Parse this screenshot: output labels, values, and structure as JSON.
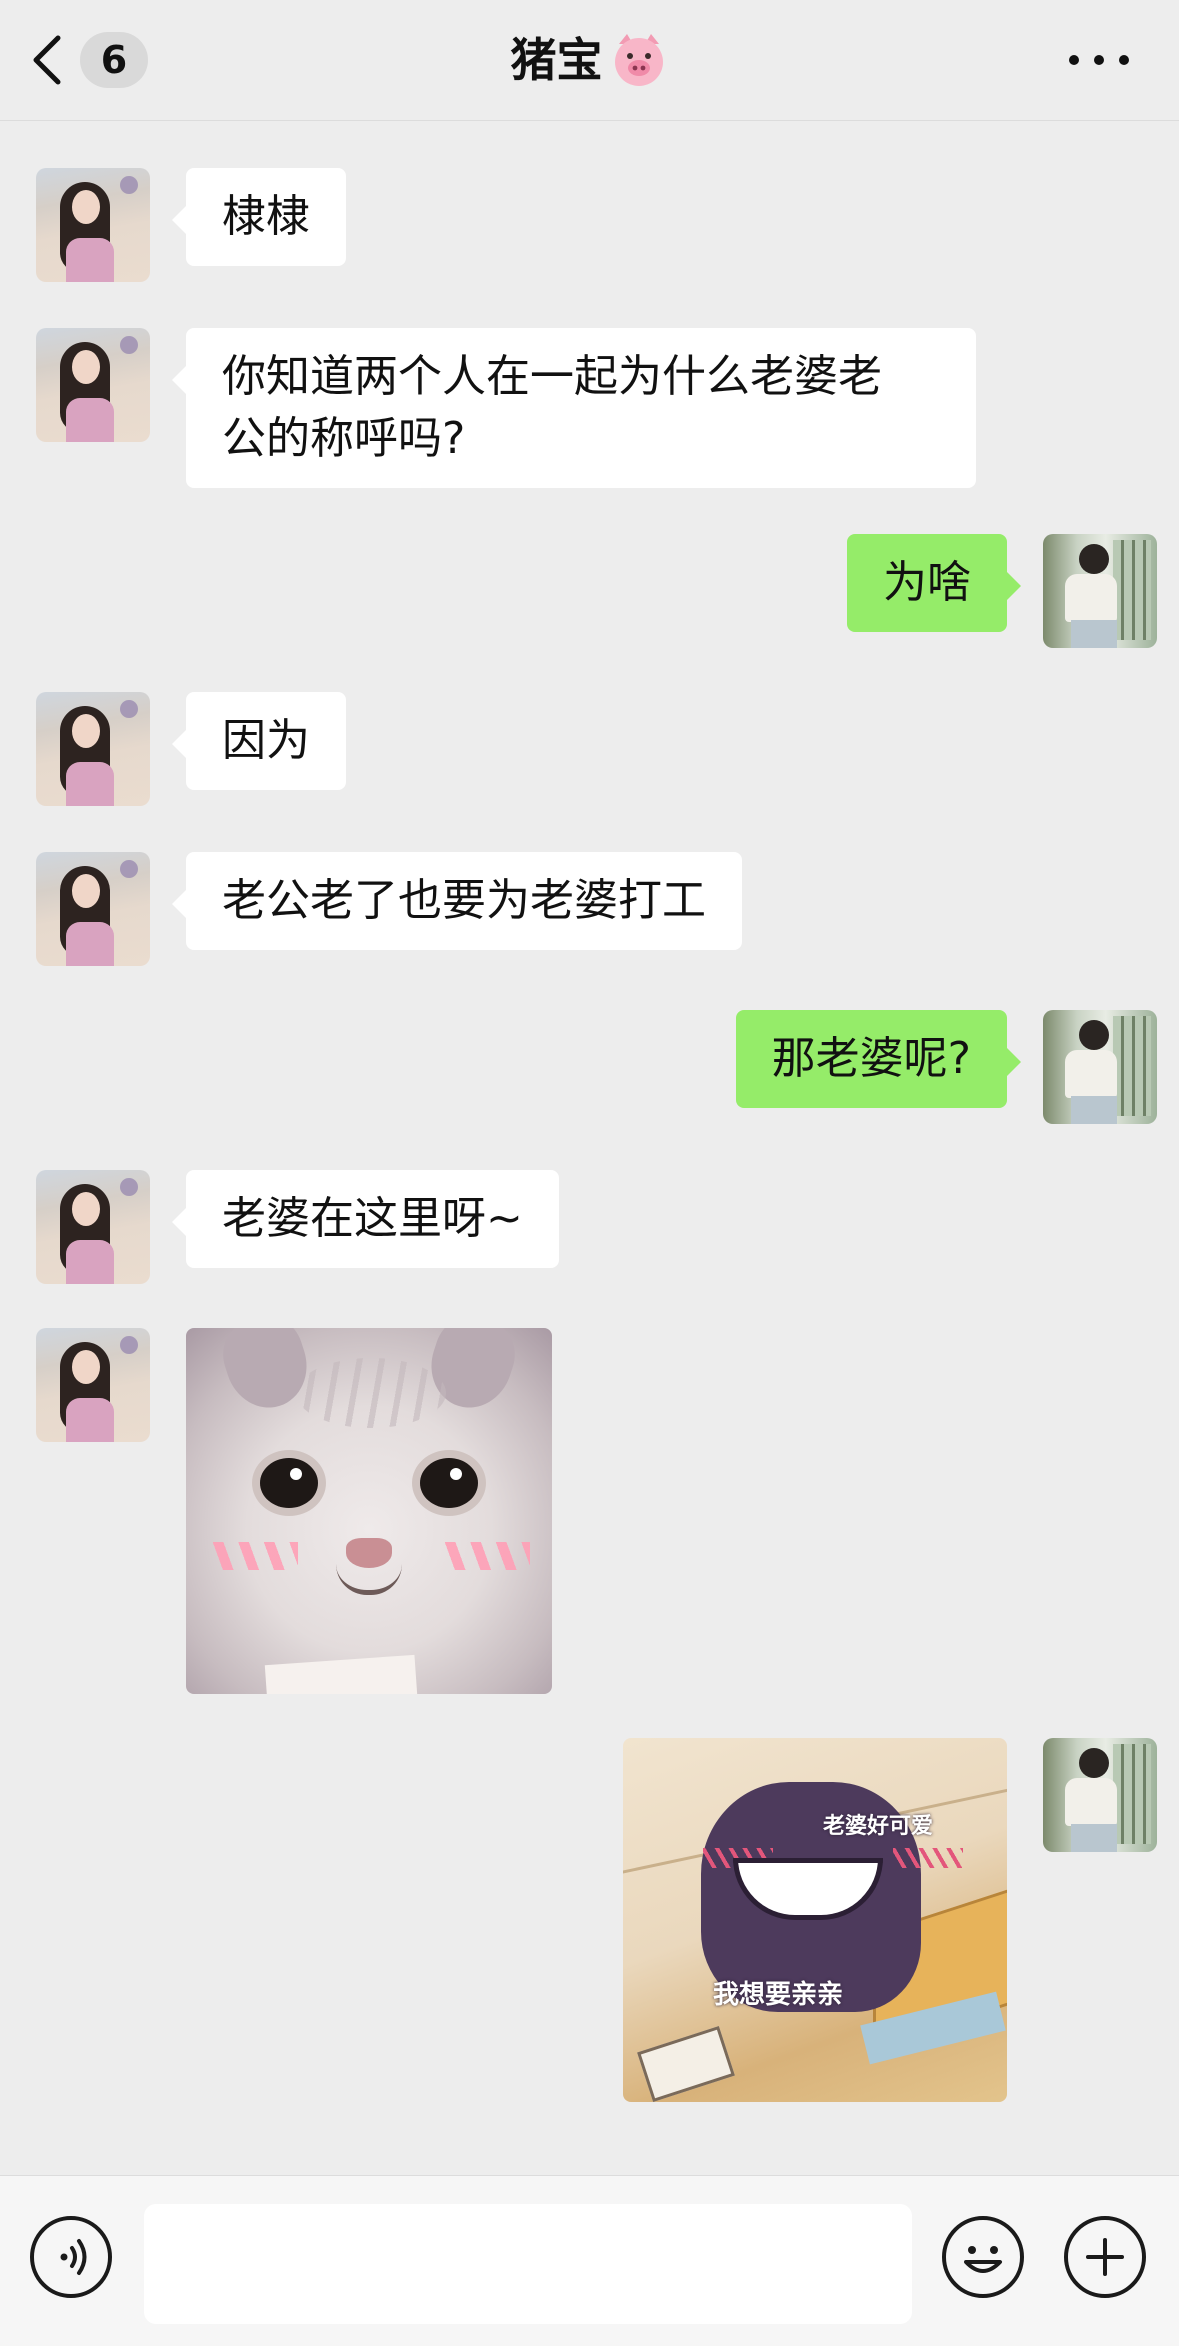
{
  "header": {
    "unread_count": "6",
    "title": "猪宝",
    "title_emoji": "🐷"
  },
  "messages": [
    {
      "side": "left",
      "type": "text",
      "text": "棣棣"
    },
    {
      "side": "left",
      "type": "text",
      "lines": [
        "你知道两个人在一起为什么老婆老",
        "公的称呼吗?"
      ]
    },
    {
      "side": "right",
      "type": "text",
      "text": "为啥"
    },
    {
      "side": "left",
      "type": "text",
      "text": "因为"
    },
    {
      "side": "left",
      "type": "text",
      "text": "老公老了也要为老婆打工"
    },
    {
      "side": "right",
      "type": "text",
      "text": "那老婆呢?"
    },
    {
      "side": "left",
      "type": "text",
      "text": "老婆在这里呀~"
    },
    {
      "side": "left",
      "type": "sticker",
      "icon": "blushing-cat-sticker"
    },
    {
      "side": "right",
      "type": "sticker",
      "icon": "gengar-sticker",
      "captions": [
        "老婆好可爱",
        "我想要亲亲"
      ]
    }
  ],
  "colors": {
    "background": "#ededed",
    "incoming_bubble": "#ffffff",
    "outgoing_bubble": "#95ec69"
  },
  "input_bar": {
    "value": "",
    "icons": [
      "voice-icon",
      "emoji-icon",
      "plus-icon"
    ]
  }
}
